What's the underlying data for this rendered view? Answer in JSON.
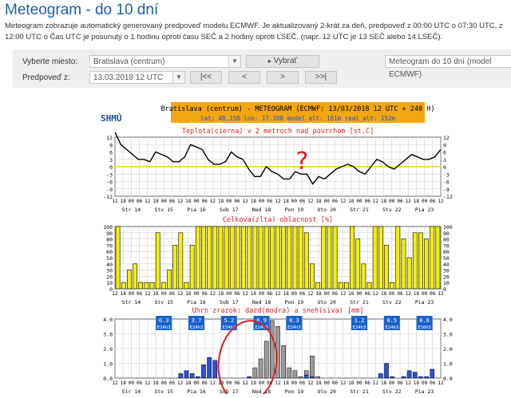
{
  "page": {
    "title": "Meteogram - do 10 dní",
    "intro": "Meteogram zobrazuje automatický generovaný predpoveď modelu ECMWF. Je aktualizovaný 2-krát za deň, predpoveď z 00:00 UTC o 07:30 UTC, z 12:00 UTC o Čas UTC je posunutý o 1 hodinu oproti času SEČ a 2 hodiny oproti LSEČ. (napr. 12 UTC je 13 SEČ alebo 14 LSEČ)."
  },
  "form": {
    "place_label": "Vyberte miesto:",
    "place_value": "Bratislava (centrum)",
    "select_button": "Vybrať",
    "model_value": "Meteogram do 10 dní (model ECMWF)",
    "forecast_label": "Predpoveď z:",
    "forecast_value": "13.03.2018 12 UTC",
    "nav_first": "|<<",
    "nav_prev": "<",
    "nav_next": ">",
    "nav_last": ">>|"
  },
  "meteogram": {
    "logo": "SHMÚ",
    "header_line": "Bratislava (centrum) - METEOGRAM (ECMWF: 13/03/2018 12 UTC + 240 H)",
    "header_sub": "lat: 48.158 lon: 17.108 model_alt: 161m real_alt: 152m",
    "temp_title": "Teplota(cierna) v 2 metroch nad povrchom [st.C]",
    "cloud_title": "Celkova(zlta) oblacnost [%]",
    "precip_title": "Uhrn zrazok: dazd(modra) a sneh(siva) [mm]",
    "hour_labels": [
      "12",
      "18",
      "00",
      "06",
      "12",
      "18",
      "00",
      "06",
      "12",
      "18",
      "00",
      "06",
      "12",
      "18",
      "00",
      "06",
      "12",
      "18",
      "00",
      "06",
      "12",
      "18",
      "00",
      "06",
      "12",
      "18",
      "00",
      "06",
      "12",
      "18",
      "00",
      "06",
      "12",
      "18",
      "00",
      "06",
      "12",
      "18",
      "00",
      "06",
      "12"
    ],
    "day_labels": [
      "Str 14",
      "Stv 15",
      "Pia 16",
      "Sob 17",
      "Ned 18",
      "Pon 19",
      "Uto 20",
      "Str 21",
      "Stv 22",
      "Pia 23"
    ],
    "temp_ticks": [
      "12",
      "9",
      "6",
      "3",
      "0",
      "-3",
      "-6",
      "-9",
      "-12"
    ],
    "cloud_ticks": [
      "100",
      "90",
      "80",
      "70",
      "60",
      "50",
      "40",
      "30",
      "20",
      "10",
      "0"
    ],
    "precip_ticks": [
      "4.0",
      "3.0",
      "2.0",
      "1.0",
      "0.0"
    ],
    "annotation_mark": "?",
    "precip_boxes": [
      {
        "value": "0.3",
        "label": "E24h3"
      },
      {
        "value": "3.7",
        "label": "E24h3"
      },
      {
        "value": "5.2",
        "label": "E24h3"
      },
      {
        "value": "6.9",
        "label": "E24h3"
      },
      {
        "value": "0.3",
        "label": "E24h3"
      },
      {
        "value": "1.2",
        "label": "E24h3"
      },
      {
        "value": "0.5",
        "label": "E24h3"
      },
      {
        "value": "0.6",
        "label": "E16h3"
      }
    ]
  },
  "chart_data": [
    {
      "type": "line",
      "title": "Teplota(cierna) v 2 metroch nad povrchom [st.C]",
      "ylim": [
        -12,
        12
      ],
      "x_step_hours": 6,
      "values": [
        14,
        9,
        7,
        5,
        3,
        3,
        2,
        6,
        5,
        4,
        2,
        2,
        4,
        9,
        8,
        7,
        3,
        1,
        1,
        2,
        6,
        4,
        3,
        -1,
        -4,
        -4,
        0,
        -2,
        -3,
        -5,
        -5,
        -2,
        -3,
        -3,
        -7,
        -4,
        -5,
        -3,
        -1,
        0,
        1,
        0,
        -2,
        -3,
        0,
        3,
        2,
        0,
        -1,
        1,
        3,
        5,
        4,
        3,
        3,
        4,
        7
      ]
    },
    {
      "type": "bar",
      "title": "Celkova(zlta) oblacnost [%]",
      "ylim": [
        0,
        100
      ],
      "x_step_hours": 6,
      "values": [
        100,
        10,
        30,
        40,
        10,
        10,
        10,
        90,
        10,
        30,
        70,
        90,
        10,
        70,
        100,
        100,
        100,
        100,
        100,
        100,
        100,
        100,
        100,
        100,
        100,
        100,
        100,
        100,
        100,
        100,
        100,
        100,
        100,
        90,
        40,
        10,
        100,
        100,
        100,
        10,
        10,
        100,
        80,
        40,
        10,
        100,
        100,
        70,
        10,
        100,
        80,
        50,
        90,
        90,
        80,
        100,
        100
      ]
    },
    {
      "type": "bar",
      "title": "Uhrn zrazok: dazd(modra) a sneh(siva) [mm]",
      "ylim": [
        0,
        4
      ],
      "x_step_hours": 6,
      "rain": [
        0,
        0,
        0,
        0,
        0,
        0,
        0,
        0,
        0,
        0,
        0,
        0.3,
        0.5,
        0.3,
        0.1,
        0.9,
        1.4,
        1.2,
        0,
        0,
        0,
        0,
        0,
        0.1,
        0,
        0,
        0,
        0,
        0,
        0,
        0,
        0,
        0,
        0.2,
        0.1,
        0,
        0,
        0,
        0,
        0,
        0,
        0,
        0,
        0,
        0,
        0,
        0.3,
        1.0,
        0.1,
        0,
        0.1,
        0.5,
        0.4,
        0.1,
        0.1,
        0.6,
        0
      ],
      "snow": [
        0,
        0,
        0,
        0,
        0,
        0,
        0,
        0,
        0,
        0,
        0,
        0,
        0,
        0,
        0,
        0,
        0,
        0,
        0,
        0,
        0,
        0,
        0,
        0,
        0.7,
        1.3,
        2.5,
        3.9,
        3.5,
        2.2,
        0.7,
        0.5,
        0.1,
        0.3,
        1.4,
        0.1,
        0,
        0,
        0,
        0,
        0,
        0,
        0,
        0,
        0,
        0,
        0,
        0,
        0,
        0,
        0,
        0,
        0,
        0,
        0,
        0,
        0
      ]
    }
  ]
}
